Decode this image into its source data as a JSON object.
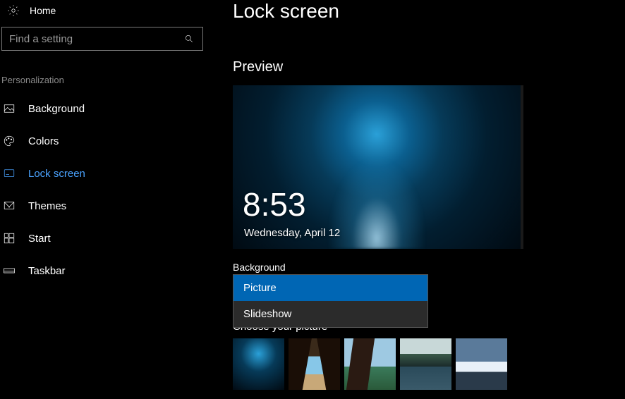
{
  "home_label": "Home",
  "search": {
    "placeholder": "Find a setting"
  },
  "section": "Personalization",
  "nav": {
    "background": "Background",
    "colors": "Colors",
    "lockscreen": "Lock screen",
    "themes": "Themes",
    "start": "Start",
    "taskbar": "Taskbar"
  },
  "page_title": "Lock screen",
  "preview_label": "Preview",
  "preview": {
    "time": "8:53",
    "date": "Wednesday, April 12"
  },
  "background_label": "Background",
  "dropdown": {
    "options": [
      "Picture",
      "Slideshow"
    ],
    "selected": "Picture"
  },
  "choose_label": "Choose your picture"
}
